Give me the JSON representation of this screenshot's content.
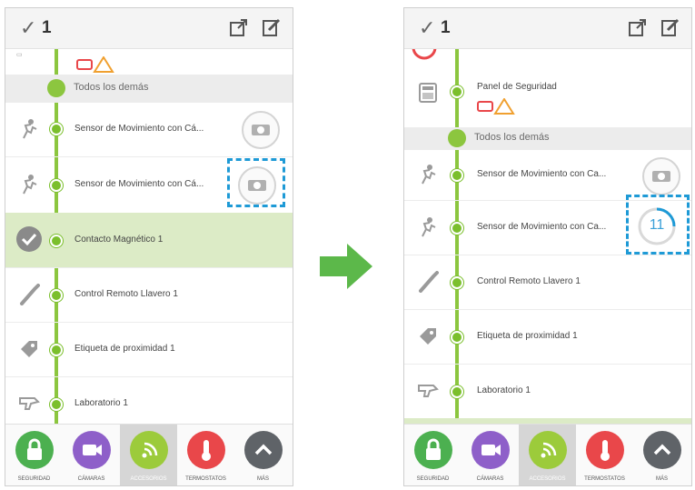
{
  "colors": {
    "accent_green": "#8cc63f",
    "highlight_blue": "#1e9ad6",
    "seguridad": "#4cb050",
    "camaras": "#8e5fc9",
    "accesorios": "#9ccb3b",
    "termostatos": "#e9474a",
    "mas": "#5f6368"
  },
  "left": {
    "topbar": {
      "check_icon": "✓",
      "count": "1"
    },
    "group_label": "Todos los demás",
    "rows": [
      {
        "label": "Sensor de Movimiento con Cá...",
        "icon": "motion-sensor-icon"
      },
      {
        "label": "Sensor de Movimiento con Cá...",
        "icon": "motion-sensor-icon"
      },
      {
        "label": "Contacto Magnético 1",
        "icon": "check-circle-icon"
      },
      {
        "label": "Control Remoto Llavero 1",
        "icon": "remote-icon"
      },
      {
        "label": "Etiqueta de proximidad 1",
        "icon": "tag-icon"
      },
      {
        "label": "Laboratorio 1",
        "icon": "outlet-icon"
      }
    ]
  },
  "right": {
    "topbar": {
      "check_icon": "✓",
      "count": "1"
    },
    "panel_label": "Panel de Seguridad",
    "group_label": "Todos los demás",
    "countdown": "11",
    "rows": [
      {
        "label": "Sensor de Movimiento con Ca...",
        "icon": "motion-sensor-icon"
      },
      {
        "label": "Sensor de Movimiento con Ca...",
        "icon": "motion-sensor-icon"
      },
      {
        "label": "Control Remoto Llavero 1",
        "icon": "remote-icon"
      },
      {
        "label": "Etiqueta de proximidad 1",
        "icon": "tag-icon"
      },
      {
        "label": "Laboratorio 1",
        "icon": "outlet-icon"
      }
    ]
  },
  "nav": [
    {
      "label": "SEGURIDAD",
      "icon": "lock-icon"
    },
    {
      "label": "CÁMARAS",
      "icon": "camera-icon"
    },
    {
      "label": "ACCESORIOS",
      "icon": "wifi-icon"
    },
    {
      "label": "TERMOSTATOS",
      "icon": "thermometer-icon"
    },
    {
      "label": "MÁS",
      "icon": "chevron-up-icon"
    }
  ]
}
